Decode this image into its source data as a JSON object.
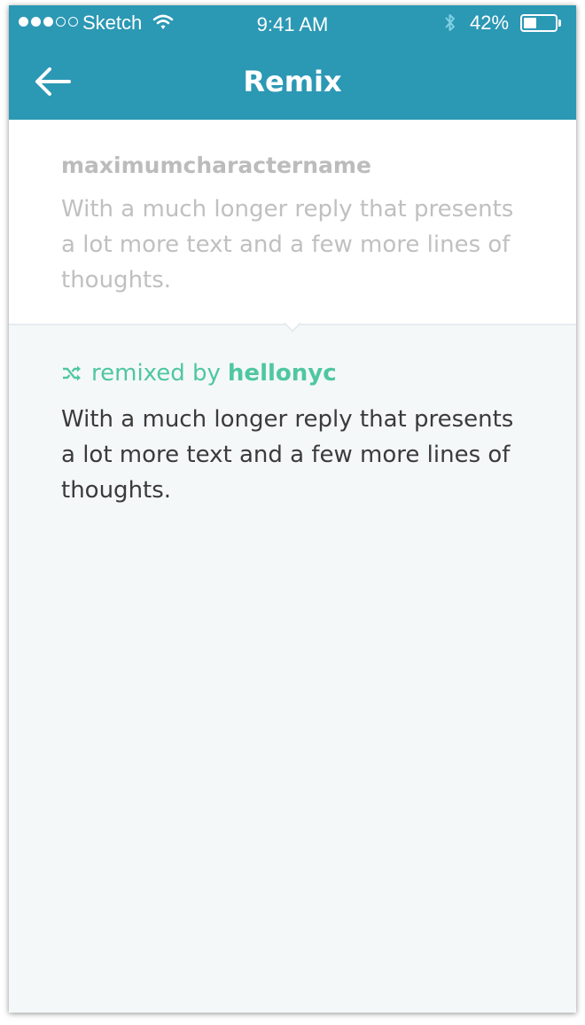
{
  "status_bar": {
    "carrier": "Sketch",
    "time": "9:41 AM",
    "battery_percent": "42%",
    "battery_level": 0.42,
    "signal_filled": 3,
    "signal_total": 5
  },
  "header": {
    "title": "Remix",
    "back_icon": "arrow-left-icon",
    "color": "#2b98b4"
  },
  "original": {
    "username": "maximumcharactername",
    "text": "With a much longer reply that presents a lot more text and a few more lines of thoughts."
  },
  "remix": {
    "icon": "shuffle-icon",
    "label": "remixed by",
    "username": "hellonyc",
    "text": "With a much longer reply that presents a lot more text and a few more lines of thoughts.",
    "accent_color": "#4fc79f"
  }
}
